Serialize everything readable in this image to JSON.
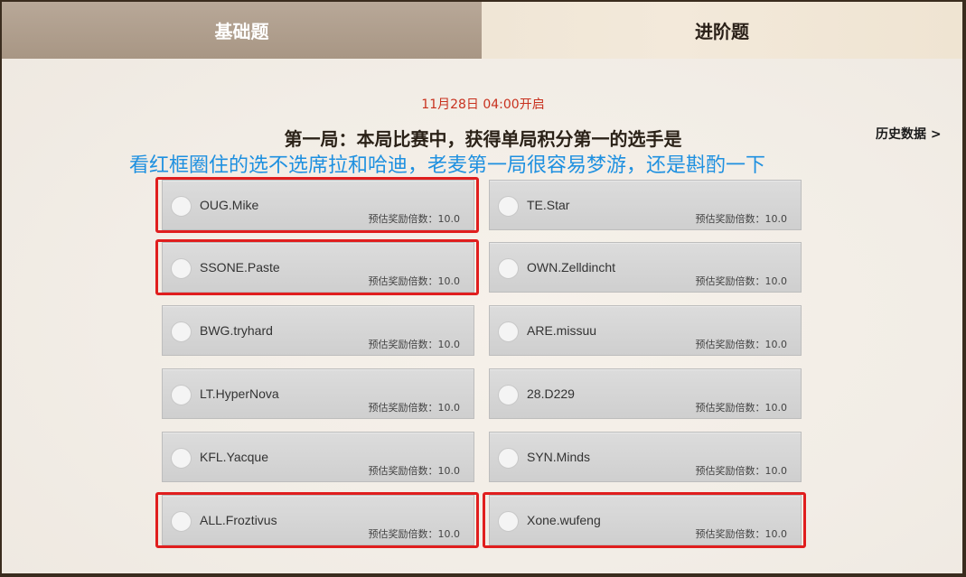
{
  "tabs": [
    {
      "label": "基础题",
      "active": true
    },
    {
      "label": "进阶题",
      "active": false
    }
  ],
  "match": {
    "time": "11月28日 04:00开启",
    "question": "第一局：本局比赛中，获得单局积分第一的选手是",
    "history_label": "历史数据 >"
  },
  "annotation": "看红框圈住的选不选席拉和哈迪，老麦第一局很容易梦游，还是斟酌一下",
  "options": [
    {
      "name": "OUG.Mike",
      "reward": "预估奖励倍数：10.0",
      "highlighted": true
    },
    {
      "name": "TE.Star",
      "reward": "预估奖励倍数：10.0",
      "highlighted": false
    },
    {
      "name": "SSONE.Paste",
      "reward": "预估奖励倍数：10.0",
      "highlighted": true
    },
    {
      "name": "OWN.Zelldincht",
      "reward": "预估奖励倍数：10.0",
      "highlighted": false
    },
    {
      "name": "BWG.tryhard",
      "reward": "预估奖励倍数：10.0",
      "highlighted": false
    },
    {
      "name": "ARE.missuu",
      "reward": "预估奖励倍数：10.0",
      "highlighted": false
    },
    {
      "name": "LT.HyperNova",
      "reward": "预估奖励倍数：10.0",
      "highlighted": false
    },
    {
      "name": "28.D229",
      "reward": "预估奖励倍数：10.0",
      "highlighted": false
    },
    {
      "name": "KFL.Yacque",
      "reward": "预估奖励倍数：10.0",
      "highlighted": false
    },
    {
      "name": "SYN.Minds",
      "reward": "预估奖励倍数：10.0",
      "highlighted": false
    },
    {
      "name": "ALL.Froztivus",
      "reward": "预估奖励倍数：10.0",
      "highlighted": true
    },
    {
      "name": "Xone.wufeng",
      "reward": "预估奖励倍数：10.0",
      "highlighted": true
    }
  ],
  "colors": {
    "highlight_box": "#e01e1e",
    "time_text": "#c8311e",
    "annotation_text": "#1e90e0"
  }
}
